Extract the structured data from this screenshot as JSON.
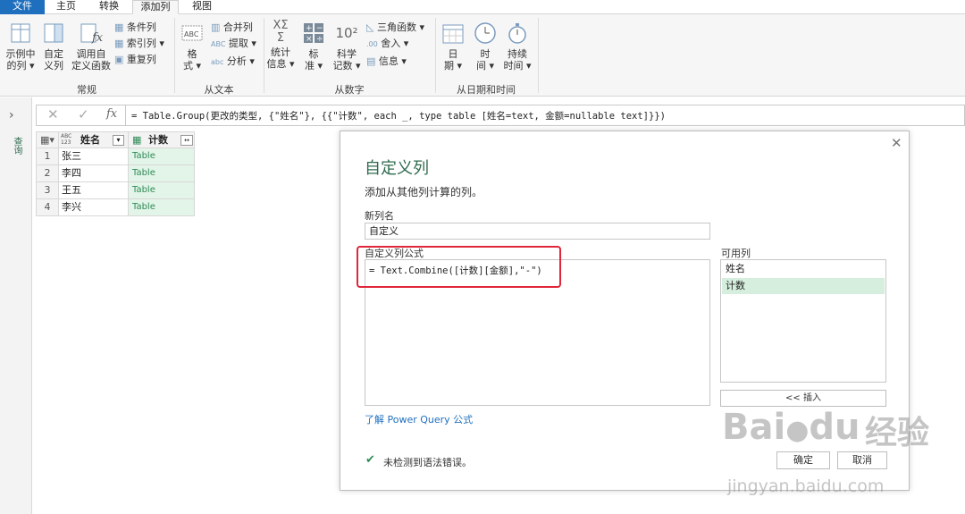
{
  "tabs": [
    "文件",
    "主页",
    "转换",
    "添加列",
    "视图"
  ],
  "ribbon": {
    "groups": [
      {
        "label": "常规",
        "buttons": [
          "示例中\n的列",
          "自定\n义列",
          "调用自\n定义函数"
        ],
        "small": [
          "条件列",
          "索引列",
          "重复列"
        ]
      },
      {
        "label": "从文本",
        "buttons": [
          "格\n式"
        ],
        "small": [
          "合并列",
          "提取",
          "分析"
        ]
      },
      {
        "label": "从数字",
        "buttons": [
          "统计\n信息",
          "标\n准",
          "科学\n记数"
        ],
        "small": [
          "三角函数",
          "舍入",
          "信息"
        ]
      },
      {
        "label": "从日期和时间",
        "buttons": [
          "日\n期",
          "时\n间",
          "持续\n时间"
        ]
      }
    ]
  },
  "leftnav": {
    "label": "查询"
  },
  "formula_bar": {
    "cancel": "✕",
    "confirm": "✓",
    "fx": "fx",
    "text": "= Table.Group(更改的类型, {\"姓名\"}, {{\"计数\", each _, type table [姓名=text, 金额=nullable text]}})"
  },
  "grid": {
    "columns": [
      {
        "type": "ABC\n123",
        "name": "姓名"
      },
      {
        "type": "▦",
        "name": "计数"
      }
    ],
    "rows": [
      {
        "n": "1",
        "name": "张三",
        "count": "Table"
      },
      {
        "n": "2",
        "name": "李四",
        "count": "Table"
      },
      {
        "n": "3",
        "name": "王五",
        "count": "Table"
      },
      {
        "n": "4",
        "name": "李兴",
        "count": "Table"
      }
    ]
  },
  "dialog": {
    "title": "自定义列",
    "subtitle": "添加从其他列计算的列。",
    "new_col_label": "新列名",
    "new_col_value": "自定义",
    "formula_label": "自定义列公式",
    "formula_value": "= Text.Combine([计数][金额],\"-\")",
    "available_label": "可用列",
    "available": [
      "姓名",
      "计数"
    ],
    "insert_button": "<< 插入",
    "learn_link": "了解 Power Query 公式",
    "status": "未检测到语法错误。",
    "ok": "确定",
    "cancel": "取消"
  },
  "watermark": {
    "brand": "Bai",
    "brand2": "du",
    "cn": "经验",
    "url": "jingyan.baidu.com"
  },
  "colors": {
    "accent": "#1f6fbf",
    "title_green": "#2f6b4e",
    "table_green": "#2e8b57",
    "highlight": "#e0263a",
    "selected_row": "#d5eedd"
  }
}
